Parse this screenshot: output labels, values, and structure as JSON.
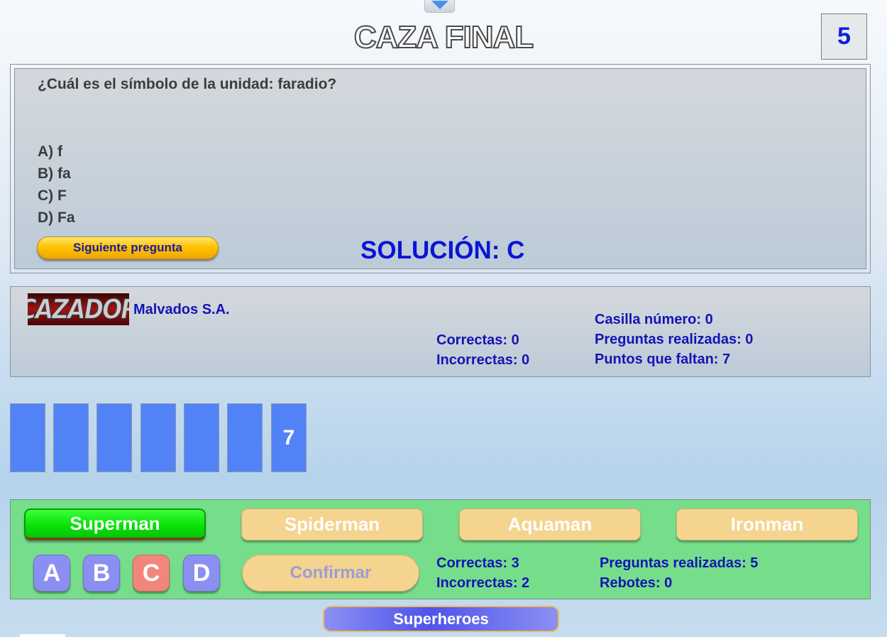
{
  "header": {
    "title": "CAZA FINAL",
    "counter": "5"
  },
  "question": {
    "text": "¿Cuál es el símbolo de la unidad: faradio?",
    "options": [
      "A) f",
      "B) fa",
      "C) F",
      "D) Fa"
    ],
    "next_label": "Siguiente pregunta",
    "solution": "SOLUCIÓN: C"
  },
  "chaser": {
    "logo_text": "CAZADOR",
    "name": "Malvados S.A.",
    "correct": "Correctas: 0",
    "incorrect": "Incorrectas: 0",
    "square": "Casilla número: 0",
    "asked": "Preguntas realizadas: 0",
    "points_left": "Puntos que faltan: 7"
  },
  "ladder": {
    "cells": [
      "",
      "",
      "",
      "",
      "",
      "",
      "7"
    ]
  },
  "team": {
    "players": [
      "Superman",
      "Spiderman",
      "Aquaman",
      "Ironman"
    ],
    "answers": [
      "A",
      "B",
      "C",
      "D"
    ],
    "confirm_label": "Confirmar",
    "correct": "Correctas: 3",
    "incorrect": "Incorrectas: 2",
    "asked": "Preguntas realizadas: 5",
    "rebounds": "Rebotes: 0",
    "team_name": "Superheroes"
  },
  "colors": {
    "accent_blue": "#0a14d8",
    "text_blue": "#1414b4",
    "ladder_cell": "#5283f6",
    "team_panel": "#76de8a",
    "active_player": "#09e209",
    "inactive_player": "#f4d48e",
    "selected_answer": "#f2867c"
  },
  "icons": {
    "toggle": "chevron-down-icon"
  }
}
